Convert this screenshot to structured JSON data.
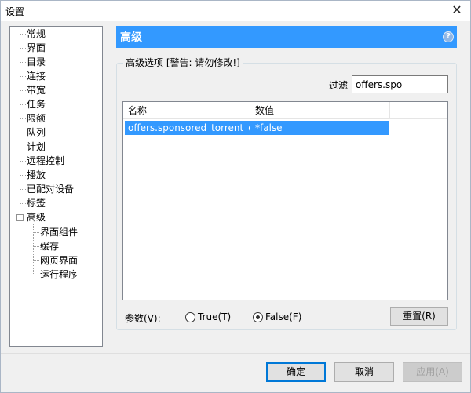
{
  "window": {
    "title": "设置",
    "close_glyph": "✕"
  },
  "tree": {
    "items": [
      {
        "label": "常规"
      },
      {
        "label": "界面"
      },
      {
        "label": "目录"
      },
      {
        "label": "连接"
      },
      {
        "label": "带宽"
      },
      {
        "label": "任务"
      },
      {
        "label": "限额"
      },
      {
        "label": "队列"
      },
      {
        "label": "计划"
      },
      {
        "label": "远程控制"
      },
      {
        "label": "播放"
      },
      {
        "label": "已配对设备"
      },
      {
        "label": "标签"
      },
      {
        "label": "高级",
        "expander": "−"
      }
    ],
    "children": [
      {
        "label": "界面组件"
      },
      {
        "label": "缓存"
      },
      {
        "label": "网页界面"
      },
      {
        "label": "运行程序"
      }
    ]
  },
  "header": {
    "title": "高级",
    "help_glyph": "?"
  },
  "group": {
    "label": "高级选项 [警告: 请勿修改!]"
  },
  "filter": {
    "label": "过滤",
    "value": "offers.spo"
  },
  "list": {
    "columns": [
      "名称",
      "数值"
    ],
    "rows": [
      {
        "name": "offers.sponsored_torrent_of...",
        "value": "*false"
      }
    ]
  },
  "param": {
    "label": "参数(V):",
    "options": [
      {
        "label": "True(T)",
        "checked": false
      },
      {
        "label": "False(F)",
        "checked": true
      }
    ],
    "reset_label": "重置(R)"
  },
  "footer": {
    "ok_label": "确定",
    "cancel_label": "取消",
    "apply_label": "应用(A)"
  },
  "colors": {
    "accent": "#3399ff",
    "selection": "#3399ff"
  }
}
